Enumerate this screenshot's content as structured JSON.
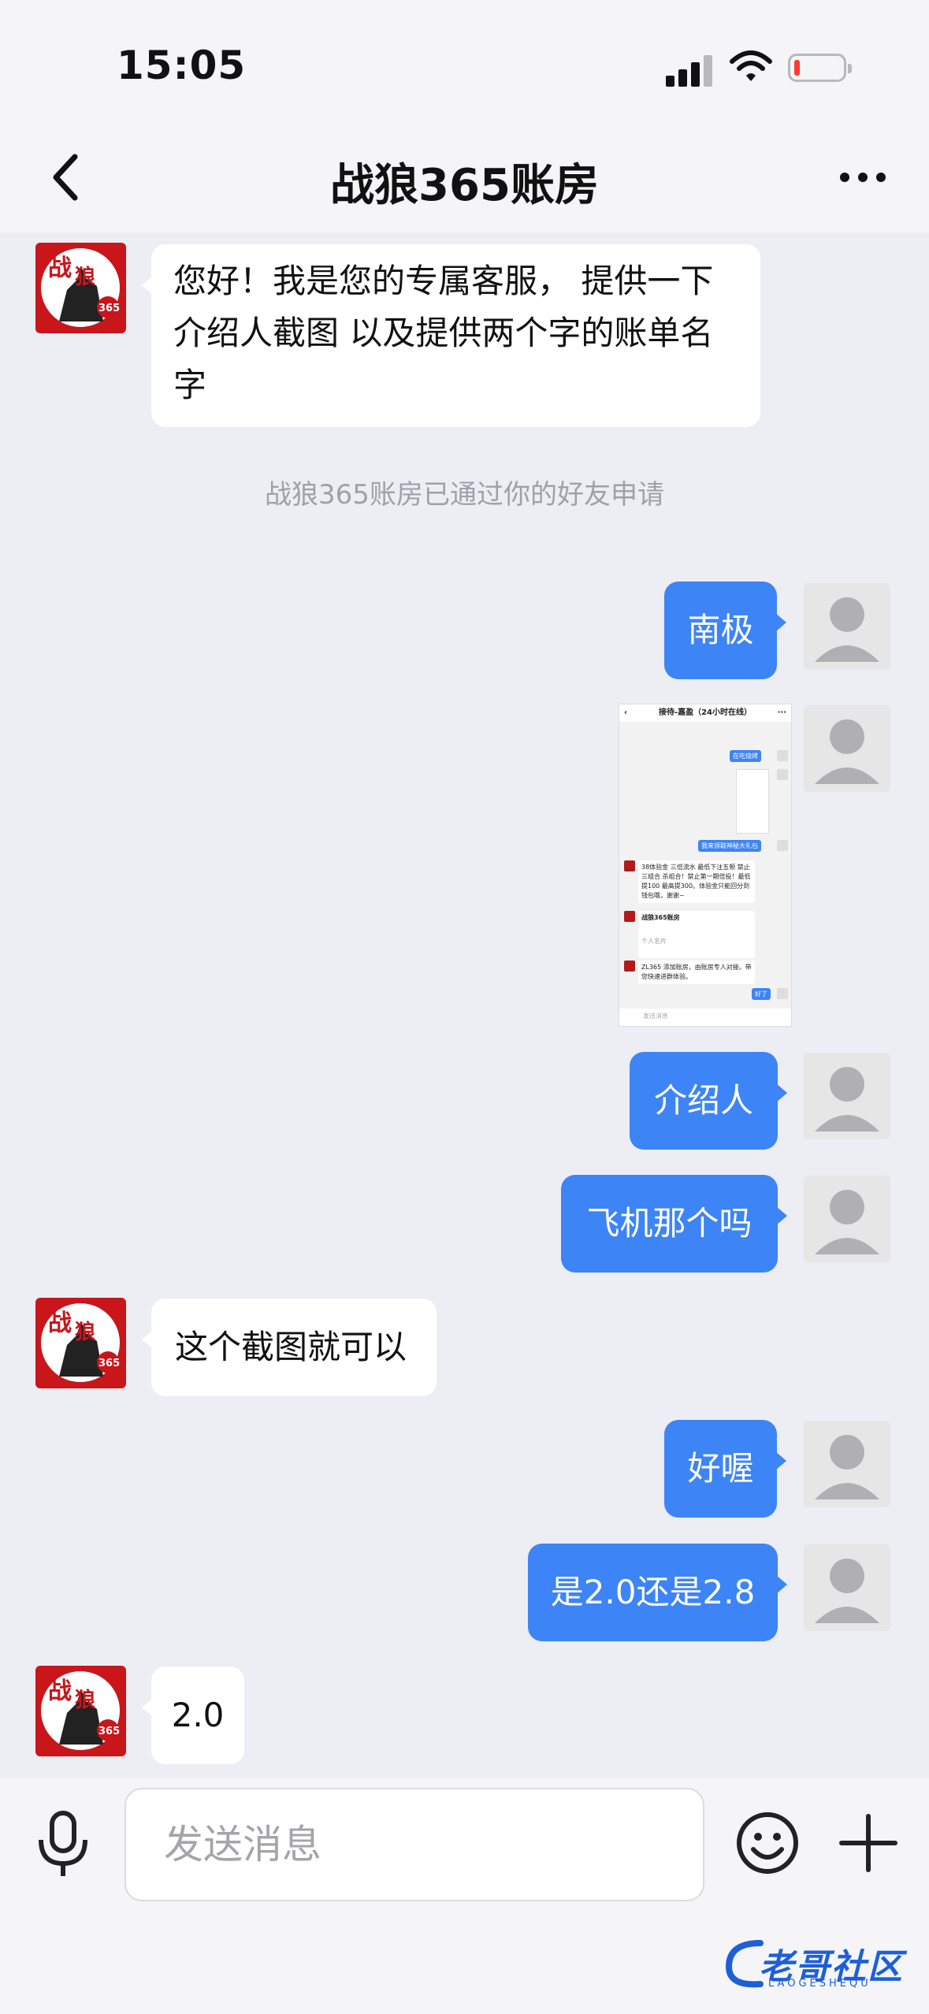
{
  "status_bar": {
    "time": "15:05"
  },
  "header": {
    "title": "战狼365账房"
  },
  "messages": [
    {
      "text": "您好！我是您的专属客服， 提供一下介绍人截图 以及提供两个字的账单名字"
    },
    {
      "text": "战狼365账房已通过你的好友申请"
    },
    {
      "text": "南极"
    },
    {
      "text": "介绍人"
    },
    {
      "text": "飞机那个吗"
    },
    {
      "text": "这个截图就可以"
    },
    {
      "text": "好喔"
    },
    {
      "text": "是2.0还是2.8"
    },
    {
      "text": "2.0"
    }
  ],
  "shared_screenshot": {
    "title": "接待-嘉盈（24小时在线）",
    "msg1": "在吃烧烤",
    "msg2": "我来领取神秘大礼包",
    "msg3": "38体验金 三倍流水 最低下注五顿 禁止三组合 杀组合！禁止第一期倍投！最低提100 最高提300。体验金只能回分到钱包哦，谢谢~",
    "card_title": "战狼365账房",
    "card_sub": "个人名片",
    "msg4": "ZL365 添加账房，由账房专人对接。带您快速进群体验。",
    "msg5": "好了",
    "input_placeholder": "发送消息"
  },
  "input_bar": {
    "placeholder": "发送消息"
  },
  "avatar_label": {
    "line1": "战",
    "line2": "狼",
    "badge": "365"
  },
  "watermark": {
    "title": "老哥社区",
    "sub": "LAOGESHEQU"
  }
}
